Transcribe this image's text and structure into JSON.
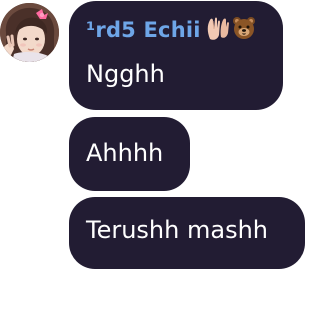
{
  "sender": {
    "name": "¹rd5 Echii",
    "badges": [
      "hands-icon",
      "bear-face-icon"
    ]
  },
  "messages": [
    {
      "text": "Ngghh"
    },
    {
      "text": "Ahhhh"
    },
    {
      "text": "Terushh mashh"
    }
  ],
  "colors": {
    "bubble": "#221c33",
    "sender_name": "#6ea6e8",
    "message_text": "#ffffff",
    "background": "#ffffff"
  }
}
